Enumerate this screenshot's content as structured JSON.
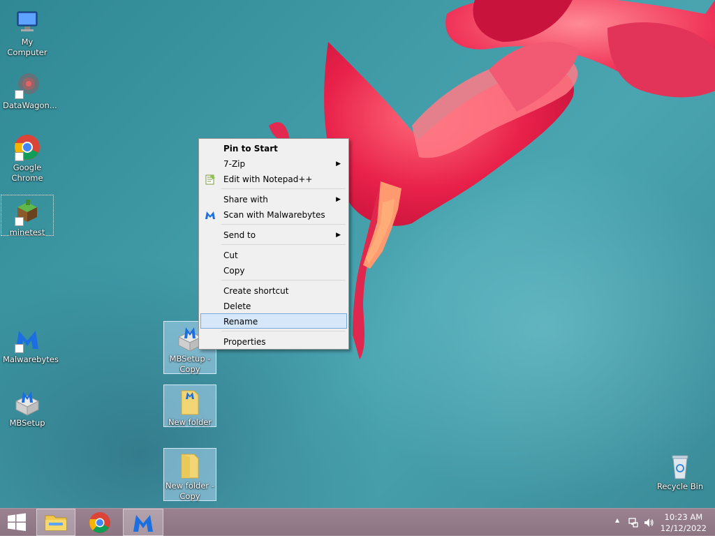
{
  "desktop": {
    "icons": [
      {
        "label": "My Computer"
      },
      {
        "label": "DataWagon..."
      },
      {
        "label": "Google Chrome"
      },
      {
        "label": "minetest"
      },
      {
        "label": "Malwarebytes"
      },
      {
        "label": "MBSetup"
      },
      {
        "label": "MBSetup - Copy"
      },
      {
        "label": "New folder"
      },
      {
        "label": "New folder - Copy"
      },
      {
        "label": "Recycle Bin"
      }
    ]
  },
  "context_menu": {
    "items": [
      {
        "label": "Pin to Start",
        "bold": true
      },
      {
        "label": "7-Zip",
        "submenu": true
      },
      {
        "label": "Edit with Notepad++",
        "icon": "notepadpp-icon"
      },
      {
        "label": "Share with",
        "submenu": true
      },
      {
        "label": "Scan with Malwarebytes",
        "icon": "malwarebytes-icon"
      },
      {
        "label": "Send to",
        "submenu": true
      },
      {
        "label": "Cut"
      },
      {
        "label": "Copy"
      },
      {
        "label": "Create shortcut"
      },
      {
        "label": "Delete"
      },
      {
        "label": "Rename",
        "highlighted": true
      },
      {
        "label": "Properties"
      }
    ],
    "submenu_arrow": "▶"
  },
  "taskbar": {
    "buttons": [
      "windows-logo-icon",
      "file-explorer-icon",
      "chrome-icon",
      "malwarebytes-icon"
    ],
    "tray_icons": [
      "show-hidden-icons-icon",
      "network-icon",
      "volume-icon"
    ],
    "tray_chevron": "▲",
    "clock": {
      "time": "10:23 AM",
      "date": "12/12/2022"
    }
  },
  "colors": {
    "menu_bg": "#f0f0f0",
    "menu_highlight": "#d5e7f8",
    "menu_highlight_border": "#7aa7d6",
    "taskbar": "#8c7482",
    "selection": "#add6f0"
  }
}
